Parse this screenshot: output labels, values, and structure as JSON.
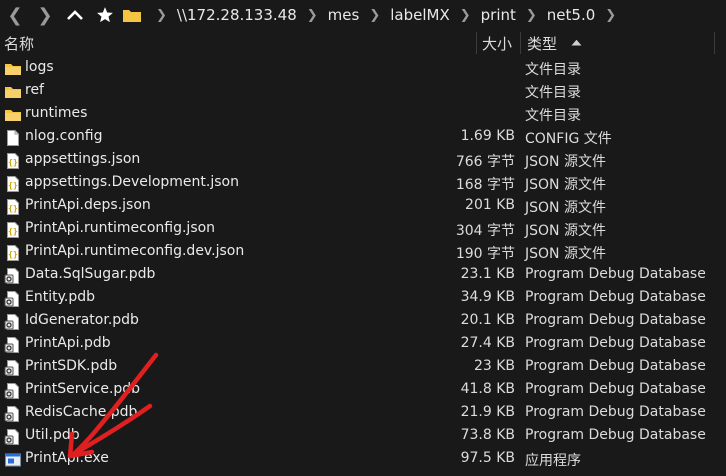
{
  "toolbar": {
    "back_icon": "chevron-left-icon",
    "forward_icon": "chevron-right-icon",
    "up_icon": "chevron-up-icon",
    "pin_icon": "star-icon",
    "breadcrumb": [
      "\\\\172.28.133.48",
      "mes",
      "labelMX",
      "print",
      "net5.0"
    ]
  },
  "columns": {
    "name": "名称",
    "size": "大小",
    "type": "类型"
  },
  "files": [
    {
      "name": "logs",
      "size": "",
      "type": "文件目录",
      "icon": "folder-icon"
    },
    {
      "name": "ref",
      "size": "",
      "type": "文件目录",
      "icon": "folder-icon"
    },
    {
      "name": "runtimes",
      "size": "",
      "type": "文件目录",
      "icon": "folder-icon"
    },
    {
      "name": "nlog.config",
      "size": "1.69 KB",
      "type": "CONFIG 文件",
      "icon": "document-icon"
    },
    {
      "name": "appsettings.json",
      "size": "766 字节",
      "type": "JSON 源文件",
      "icon": "json-file-icon"
    },
    {
      "name": "appsettings.Development.json",
      "size": "168 字节",
      "type": "JSON 源文件",
      "icon": "json-file-icon"
    },
    {
      "name": "PrintApi.deps.json",
      "size": "201 KB",
      "type": "JSON 源文件",
      "icon": "json-file-icon"
    },
    {
      "name": "PrintApi.runtimeconfig.json",
      "size": "304 字节",
      "type": "JSON 源文件",
      "icon": "json-file-icon"
    },
    {
      "name": "PrintApi.runtimeconfig.dev.json",
      "size": "190 字节",
      "type": "JSON 源文件",
      "icon": "json-file-icon"
    },
    {
      "name": "Data.SqlSugar.pdb",
      "size": "23.1 KB",
      "type": "Program Debug Database",
      "icon": "pdb-file-icon"
    },
    {
      "name": "Entity.pdb",
      "size": "34.9 KB",
      "type": "Program Debug Database",
      "icon": "pdb-file-icon"
    },
    {
      "name": "IdGenerator.pdb",
      "size": "20.1 KB",
      "type": "Program Debug Database",
      "icon": "pdb-file-icon"
    },
    {
      "name": "PrintApi.pdb",
      "size": "27.4 KB",
      "type": "Program Debug Database",
      "icon": "pdb-file-icon"
    },
    {
      "name": "PrintSDK.pdb",
      "size": "23 KB",
      "type": "Program Debug Database",
      "icon": "pdb-file-icon"
    },
    {
      "name": "PrintService.pdb",
      "size": "41.8 KB",
      "type": "Program Debug Database",
      "icon": "pdb-file-icon"
    },
    {
      "name": "RedisCache.pdb",
      "size": "21.9 KB",
      "type": "Program Debug Database",
      "icon": "pdb-file-icon"
    },
    {
      "name": "Util.pdb",
      "size": "73.8 KB",
      "type": "Program Debug Database",
      "icon": "pdb-file-icon"
    },
    {
      "name": "PrintApi.exe",
      "size": "97.5 KB",
      "type": "应用程序",
      "icon": "exe-file-icon"
    }
  ],
  "colors": {
    "background": "#191919",
    "folder": "#f4c542",
    "annotation_arrow": "#e02020",
    "exe_icon": "#2a6fd6"
  },
  "annotation": {
    "icon": "red-arrow-annotation",
    "points_to": "PrintApi.exe"
  }
}
